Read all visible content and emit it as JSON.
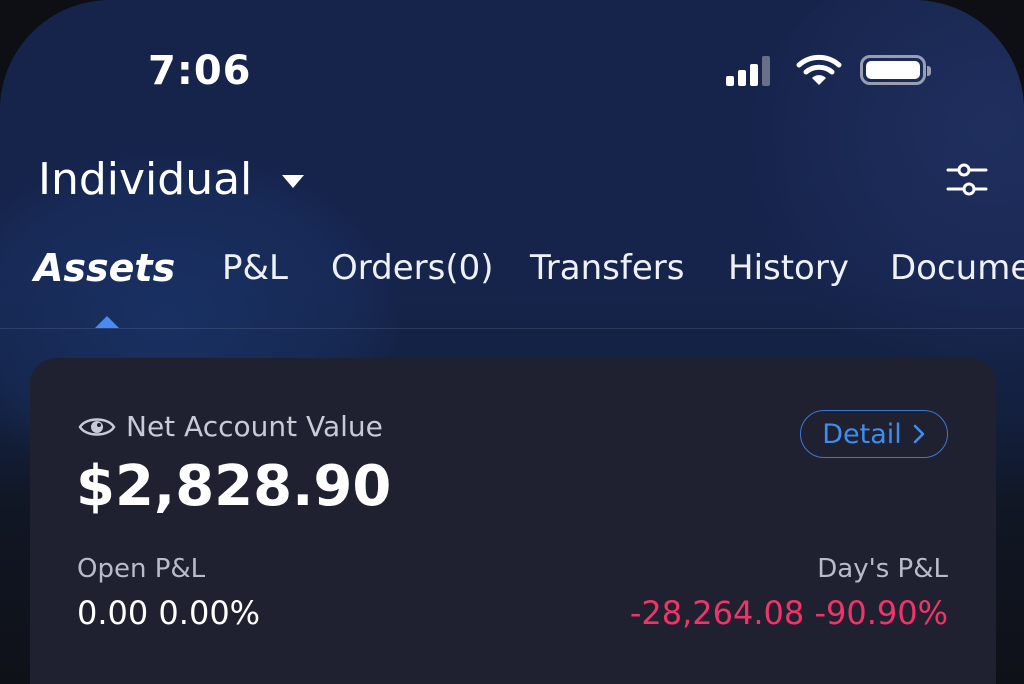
{
  "status_bar": {
    "time": "7:06",
    "signal_icon": "cellular-signal-icon",
    "wifi_icon": "wifi-icon",
    "battery_icon": "battery-icon"
  },
  "header": {
    "account_name": "Individual",
    "dropdown_icon": "caret-down-icon",
    "settings_icon": "sliders-icon"
  },
  "tabs": [
    {
      "label": "Assets",
      "active": true
    },
    {
      "label": "P&L",
      "active": false
    },
    {
      "label": "Orders(0)",
      "active": false
    },
    {
      "label": "Transfers",
      "active": false
    },
    {
      "label": "History",
      "active": false
    },
    {
      "label": "Docume",
      "active": false
    }
  ],
  "account_card": {
    "net_value_label": "Net Account Value",
    "net_value": "$2,828.90",
    "visibility_icon": "eye-icon",
    "detail_label": "Detail",
    "open_pl_label": "Open P&L",
    "open_pl_value": "0.00 0.00%",
    "day_pl_label": "Day's P&L",
    "day_pl_value": "-28,264.08 -90.90%"
  },
  "colors": {
    "accent": "#3e8ef0",
    "negative": "#f0346a",
    "card_bg": "#1f2130",
    "header_bg": "#16234a"
  }
}
